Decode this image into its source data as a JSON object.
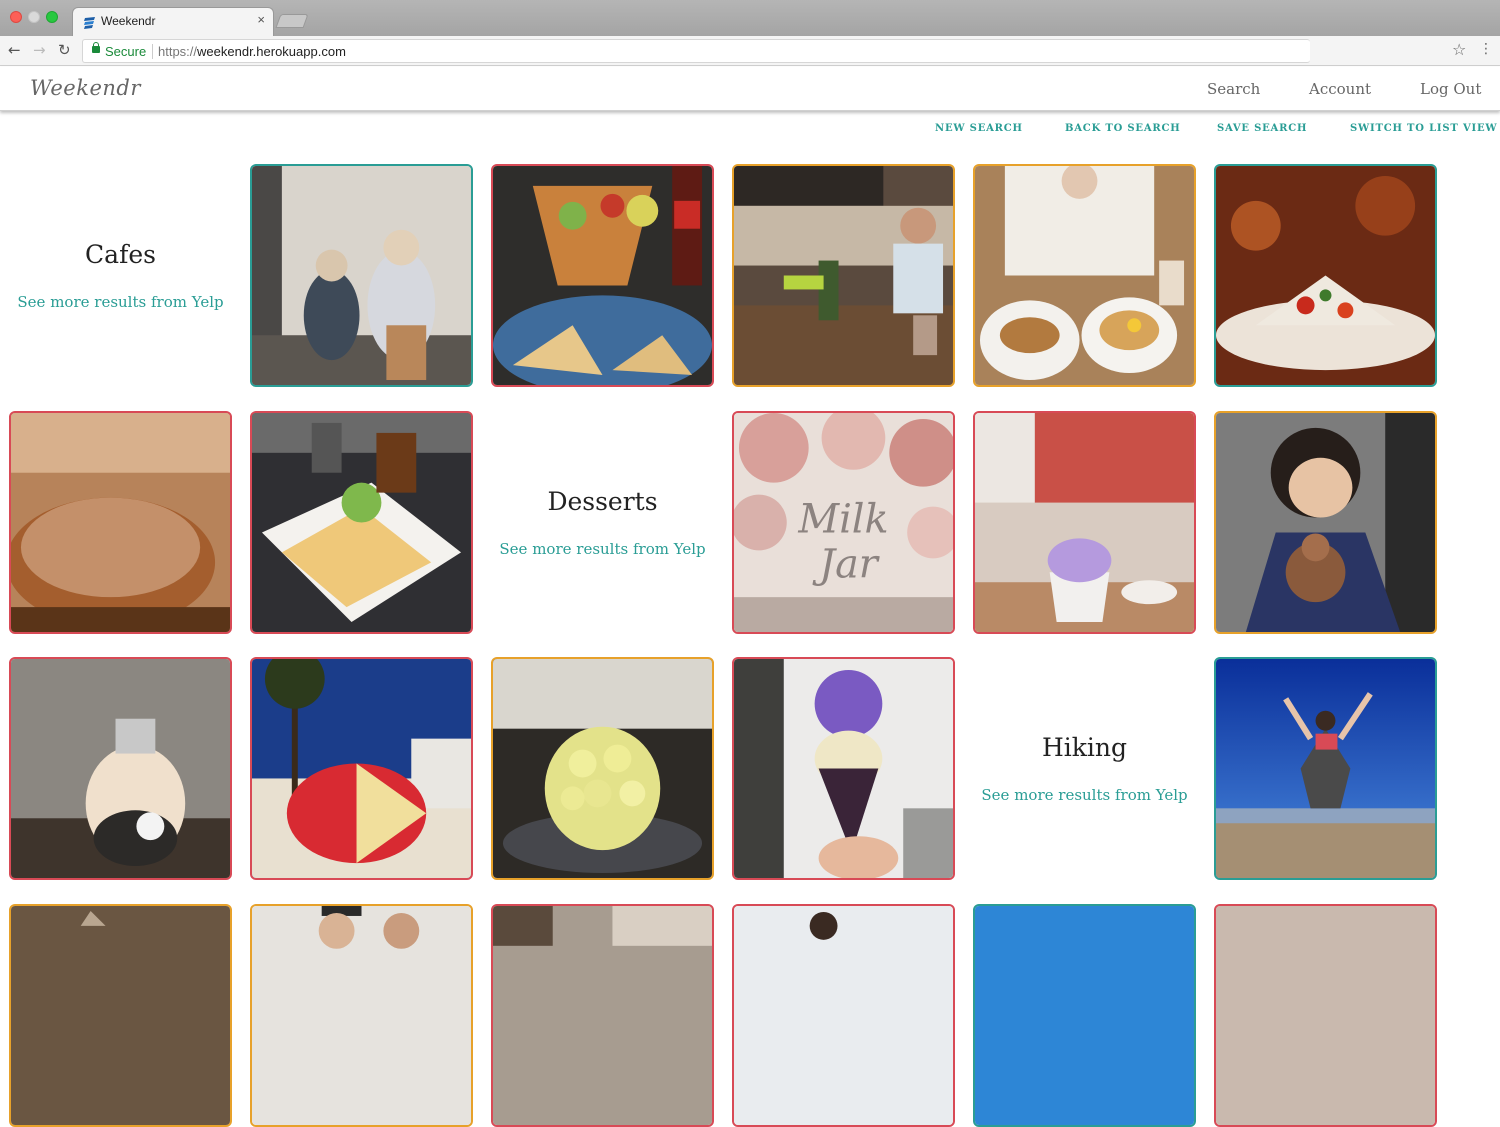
{
  "browser": {
    "tab_title": "Weekendr",
    "tab_close": "×",
    "secure_label": "Secure",
    "url_scheme": "https://",
    "url_host": "weekendr.herokuapp.com"
  },
  "app": {
    "logo": "Weekendr",
    "nav": {
      "search": "Search",
      "account": "Account",
      "logout": "Log Out"
    },
    "actions": {
      "new_search": "NEW SEARCH",
      "back_to_search": "BACK TO SEARCH",
      "save_search": "SAVE SEARCH",
      "list_view": "SWITCH TO LIST VIEW"
    }
  },
  "categories": [
    {
      "title": "Cafes",
      "link": "See more results from Yelp"
    },
    {
      "title": "Desserts",
      "link": "See more results from Yelp"
    },
    {
      "title": "Hiking",
      "link": "See more results from Yelp"
    }
  ],
  "colors": {
    "teal": "#2a9d95",
    "red": "#d84a56",
    "orange": "#e7a12a"
  },
  "photos": [
    {
      "name": "figurines-photo",
      "border": "teal"
    },
    {
      "name": "ceviche-photo",
      "border": "red"
    },
    {
      "name": "cafe-interior-photo",
      "border": "orange"
    },
    {
      "name": "brunch-table-photo",
      "border": "orange"
    },
    {
      "name": "salad-plate-photo",
      "border": "teal"
    },
    {
      "name": "sugar-donut-photo",
      "border": "red"
    },
    {
      "name": "crepe-plate-photo",
      "border": "red"
    },
    {
      "name": "milk-jar-sign-photo",
      "border": "red"
    },
    {
      "name": "ice-cream-cup-photo",
      "border": "red"
    },
    {
      "name": "child-with-cone-photo",
      "border": "orange"
    },
    {
      "name": "lightbulb-drink-photo",
      "border": "red"
    },
    {
      "name": "palm-tree-dessert-photo",
      "border": "red"
    },
    {
      "name": "melon-shaved-ice-photo",
      "border": "orange"
    },
    {
      "name": "ube-cone-photo",
      "border": "red"
    },
    {
      "name": "jumping-hiker-photo",
      "border": "teal"
    }
  ]
}
